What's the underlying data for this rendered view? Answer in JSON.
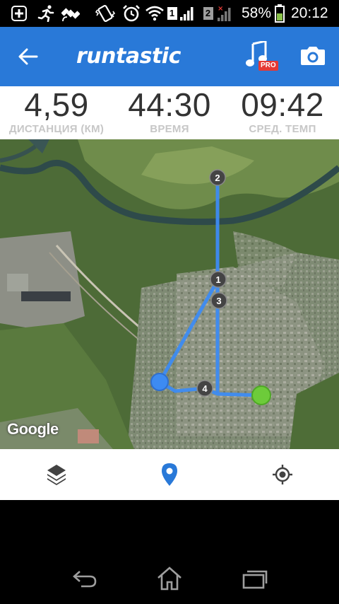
{
  "status_bar": {
    "sim1": "1",
    "sim2": "2",
    "battery_percent": "58%",
    "time": "20:12",
    "icons": [
      "add-icon",
      "running-icon",
      "satellite-icon",
      "vibrate-icon",
      "alarm-icon",
      "wifi-icon",
      "signal-sim1-icon",
      "signal-sim2-icon",
      "battery-icon"
    ]
  },
  "app_bar": {
    "logo": "runtastic",
    "pro_badge": "PRO",
    "icons": [
      "back-arrow-icon",
      "music-icon",
      "camera-icon"
    ]
  },
  "stats": {
    "distance": {
      "value": "4,59",
      "label": "ДИСТАНЦИЯ (КМ)"
    },
    "duration": {
      "value": "44:30",
      "label": "ВРЕМЯ"
    },
    "pace": {
      "value": "09:42",
      "label": "СРЕД. ТЕМП"
    }
  },
  "map": {
    "attribution": "Google",
    "route_color": "#3d8bf2",
    "start_color": "#3d8bf2",
    "end_color": "#6dcb3a",
    "markers": [
      "1",
      "2",
      "3",
      "4"
    ]
  },
  "toolbar": {
    "icons": [
      "layers-icon",
      "location-pin-icon",
      "my-location-icon"
    ],
    "active_color": "#2979d8"
  },
  "nav_bar": {
    "icons": [
      "back-icon",
      "home-icon",
      "recent-apps-icon"
    ]
  }
}
